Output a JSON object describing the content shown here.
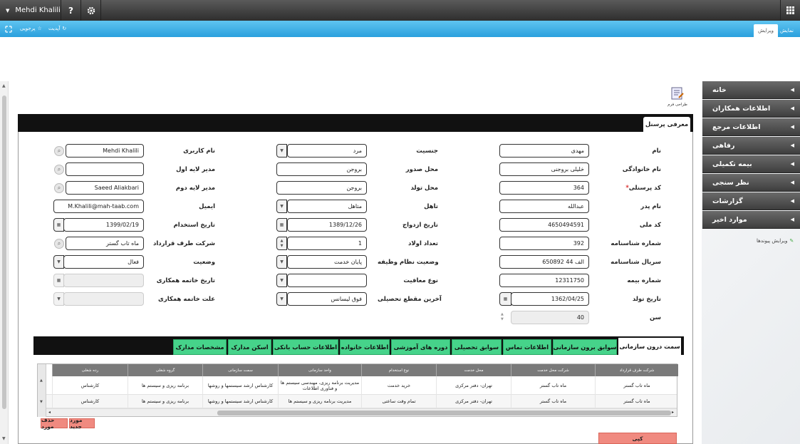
{
  "topbar": {
    "user": "Mehdi Khalili",
    "help": "?",
    "settings_icon": "gear-icon",
    "apps_icon": "grid-icon"
  },
  "toolbar": {
    "search": "پرجویی",
    "update": "آپدیت",
    "tab_edit": "ویرایش",
    "tab_show": "نمایش"
  },
  "design_form": "طراحی فرم",
  "sidebar": {
    "items": [
      {
        "label": "خانه"
      },
      {
        "label": "اطلاعات همکاران"
      },
      {
        "label": "اطلاعات مرجع"
      },
      {
        "label": "رفاهی"
      },
      {
        "label": "بیمه تکمیلی"
      },
      {
        "label": "نظر سنجی"
      },
      {
        "label": "گزارشات"
      },
      {
        "label": "موارد اخیر"
      }
    ],
    "edit_links": "ویرایش پیوندها"
  },
  "form": {
    "tab": "معرفی پرسنل",
    "col1": {
      "labels": [
        "نام",
        "نام خانوادگی",
        "کد پرسنلی",
        "نام پدر",
        "کد ملی",
        "شماره شناسنامه",
        "سریال شناسنامه",
        "شماره بیمه",
        "تاریخ تولد",
        "سن"
      ],
      "required": "*",
      "values": [
        "مهدی",
        "خلیلی بروجنی",
        "364",
        "عبدالله",
        "4650494591",
        "392",
        "650892 الف 44",
        "12311750",
        "1362/04/25",
        "40"
      ]
    },
    "col2": {
      "labels": [
        "جنسیت",
        "محل صدور",
        "محل تولد",
        "تاهل",
        "تاریخ ازدواج",
        "تعداد اولاد",
        "وضعیت نظام وظیفه",
        "نوع معافیت",
        "آخرین مقطع تحصیلی"
      ],
      "values": [
        "مرد",
        "بروجن",
        "بروجن",
        "متاهل",
        "1389/12/26",
        "1",
        "پایان خدمت",
        "",
        "فوق لیسانس"
      ]
    },
    "col3": {
      "labels": [
        "نام کاربری",
        "مدیر لایه اول",
        "مدیر لایه دوم",
        "ایمیل",
        "تاریخ استخدام",
        "شرکت طرف قرارداد",
        "وضعیت",
        "تاریخ خاتمه همکاری",
        "علت خاتمه همکاری"
      ],
      "values": [
        "Mehdi Khalili",
        "",
        "Saeed Aliakbari",
        "M.Khalili@mah-taab.com",
        "1399/02/19",
        "ماه تاب گستر",
        "فعال",
        "",
        ""
      ]
    }
  },
  "detail_tabs": [
    "سمت درون سازمانی",
    "سوابق برون سازمانی",
    "اطلاعات تماس",
    "سوابق تحصیلی",
    "دوره های آموزشی",
    "اطلاعات خانواده",
    "اطلاعات حساب بانکی",
    "اسکن مدارک",
    "مشخصات مدارک"
  ],
  "grid": {
    "headers": [
      "شرکت طرف قرارداد",
      "شرکت محل خدمت",
      "محل خدمت",
      "نوع استخدام",
      "واحد سازمانی",
      "سمت سازمانی",
      "گروه شغلی",
      "رده شغلی"
    ],
    "rows": [
      [
        "ماه تاب گستر",
        "ماه تاب گستر",
        "تهران- دفتر مرکزی",
        "خرید خدمت",
        "مدیریت برنامه ریزی، مهندسی سیستم ها و فناوری اطلاعات",
        "کارشناس ارشد سیستمها و روشها",
        "برنامه ریزی و سیستم ها",
        "کارشناس"
      ],
      [
        "ماه تاب گستر",
        "ماه تاب گستر",
        "تهران- دفتر مرکزی",
        "تمام وقت ساعتی",
        "مدیریت برنامه ریزی و سیستم ها",
        "کارشناس ارشد سیستمها و روشها",
        "برنامه ریزی و سیستم ها",
        "کارشناس"
      ]
    ]
  },
  "buttons": {
    "new": "مورد جدید",
    "delete": "حذف مورد",
    "copy": "کپی"
  }
}
